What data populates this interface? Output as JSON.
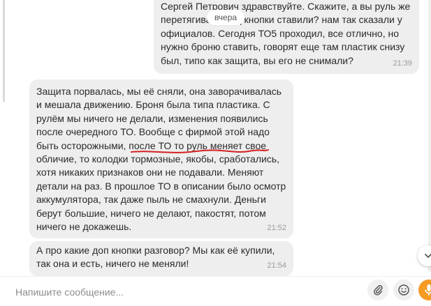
{
  "messages": {
    "outgoing": {
      "lines": [
        "Сергей Петрович здравствуйте. Скажите, а вы руль же",
        "перетягивали под кнопки ставили? нам так сказали у",
        "официалов. Сегодня ТО5 проходил, все отлично, но",
        "нужно броню ставить, говорят еще там пластик снизу",
        "был, типо как защита, вы его не снимали?"
      ],
      "time": "21:39"
    },
    "incoming_1": {
      "lines": [
        "Защита порвалась, мы её сняли,  она заворачивалась",
        "и мешала движению. Броня была типа пластика. С",
        "рулём мы ничего не делали, изменения появились",
        "после очередного ТО. Вообще с фирмой этой надо",
        "быть осторожными, после ТО то руль меняет свое",
        "обличие, то колодки тормозные, якобы, сработались,",
        "хотя никаких признаков они не подавали. Меняют",
        "детали на раз. В прошлое ТО в описании было осмотр",
        "аккумулятора, так даже пыль не смахнули. Деньги",
        "берут большие, ничего не делают, пакостят, потом",
        "ничего не докажешь."
      ],
      "time": "21:52"
    },
    "incoming_2": {
      "lines": [
        "А про какие доп кнопки разговор? Мы как её купили,",
        "так она и есть, ничего не меняли!"
      ],
      "time": "21:54"
    }
  },
  "date_badge": "вчера",
  "composer": {
    "placeholder": "Напишите сообщение...",
    "value": ""
  },
  "icons": {
    "attach": "paperclip-icon",
    "emoji": "smiley-icon",
    "mic": "microphone-icon",
    "scroll_down": "chevron-down-icon"
  },
  "colors": {
    "bubble": "#eeeeee",
    "accent": "#f59a23",
    "scribble": "#d42020",
    "time_text": "#9a9a9a"
  }
}
